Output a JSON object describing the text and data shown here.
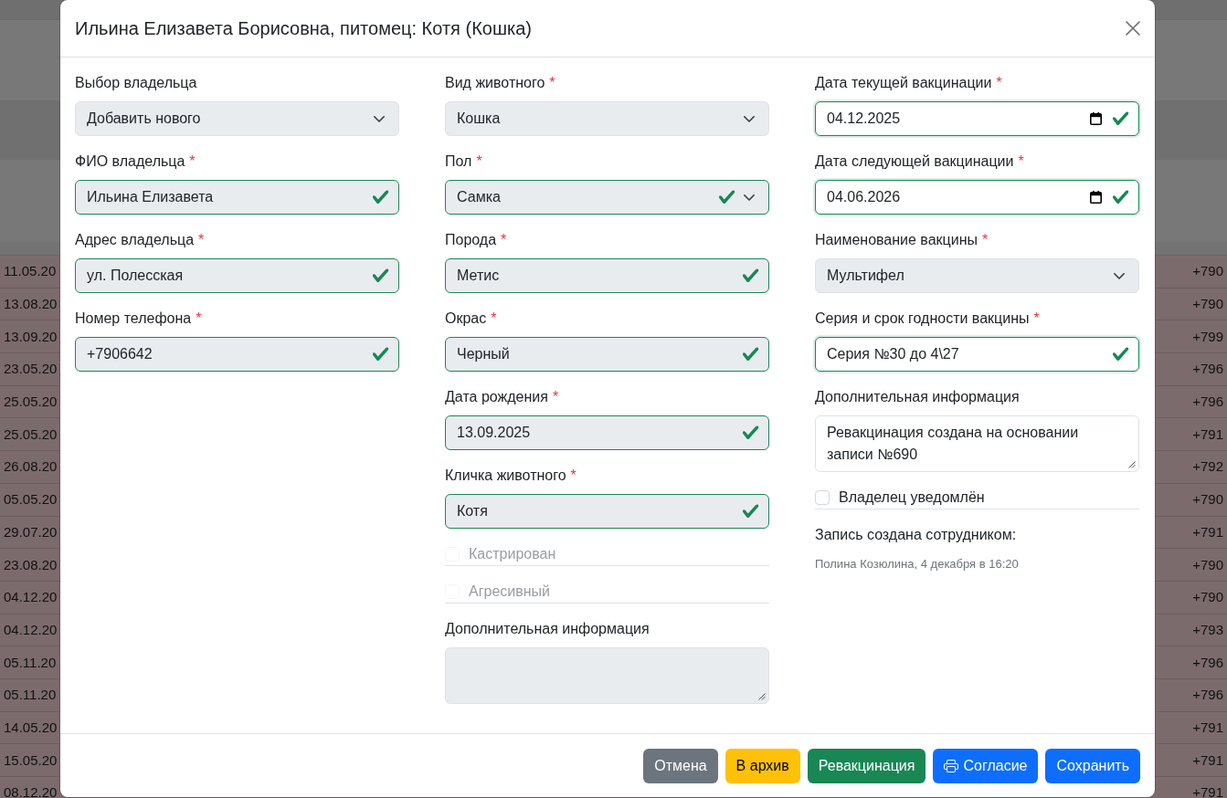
{
  "background_table": {
    "rows": [
      {
        "date": "11.05.20",
        "phone": "+790"
      },
      {
        "date": "13.08.20",
        "phone": "+790"
      },
      {
        "date": "13.09.20",
        "phone": "+799"
      },
      {
        "date": "23.05.20",
        "phone": "+796"
      },
      {
        "date": "25.05.20",
        "phone": "+796"
      },
      {
        "date": "25.05.20",
        "phone": "+791"
      },
      {
        "date": "26.08.20",
        "phone": "+792"
      },
      {
        "date": "05.05.20",
        "phone": "+790"
      },
      {
        "date": "29.07.20",
        "phone": "+791"
      },
      {
        "date": "23.08.20",
        "phone": "+790"
      },
      {
        "date": "04.12.20",
        "phone": "+790"
      },
      {
        "date": "04.12.20",
        "phone": "+793"
      },
      {
        "date": "05.11.20",
        "phone": "+796"
      },
      {
        "date": "05.11.20",
        "phone": "+796"
      },
      {
        "date": "14.05.20",
        "phone": "+791"
      },
      {
        "date": "15.05.20",
        "phone": "+791"
      },
      {
        "date": "08.12.20",
        "phone": "+791"
      }
    ]
  },
  "modal": {
    "title": "Ильина Елизавета Борисовна, питомец: Котя (Кошка)",
    "columns": [
      {
        "items": [
          {
            "kind": "select",
            "label": "Выбор владельца",
            "value": "Добавить нового",
            "disabled": true,
            "valid": false
          },
          {
            "kind": "text",
            "label": "ФИО владельца",
            "required_mark": "*",
            "value": "Ильина Елизавета",
            "disabled": true,
            "valid": true
          },
          {
            "kind": "text",
            "label": "Адрес владельца",
            "required_mark": "*",
            "value": "ул. Полесская",
            "disabled": true,
            "valid": true
          },
          {
            "kind": "text",
            "label": "Номер телефона",
            "required_mark": "*",
            "value": "+7906642",
            "disabled": true,
            "valid": true
          }
        ]
      },
      {
        "items": [
          {
            "kind": "select",
            "label": "Вид животного",
            "required_mark": "*",
            "value": "Кошка",
            "disabled": true,
            "valid": false
          },
          {
            "kind": "select",
            "label": "Пол",
            "required_mark": "*",
            "value": "Самка",
            "disabled": true,
            "valid": true
          },
          {
            "kind": "text",
            "label": "Порода",
            "required_mark": "*",
            "value": "Метис",
            "disabled": true,
            "valid": true
          },
          {
            "kind": "text",
            "label": "Окрас",
            "required_mark": "*",
            "value": "Черный",
            "disabled": true,
            "valid": true
          },
          {
            "kind": "text",
            "label": "Дата рождения",
            "required_mark": "*",
            "value": "13.09.2025",
            "disabled": true,
            "valid": true
          },
          {
            "kind": "text",
            "label": "Кличка животного",
            "required_mark": "*",
            "value": "Котя",
            "disabled": true,
            "valid": true
          },
          {
            "kind": "checkbox",
            "label": "Кастрирован",
            "checked": false,
            "disabled": true
          },
          {
            "kind": "checkbox",
            "label": "Агресивный",
            "checked": false,
            "disabled": true
          },
          {
            "kind": "textarea",
            "label": "Дополнительная информация",
            "disabled": true
          }
        ]
      },
      {
        "items": [
          {
            "kind": "date",
            "label": "Дата текущей вакцинации",
            "required_mark": "*",
            "value": "04.12.2025",
            "disabled": false,
            "valid": true
          },
          {
            "kind": "date",
            "label": "Дата следующей вакцинации",
            "required_mark": "*",
            "value": "04.06.2026",
            "disabled": false,
            "valid": true
          },
          {
            "kind": "select",
            "label": "Наименование вакцины",
            "required_mark": "*",
            "value": "Мультифел",
            "disabled": true,
            "valid": false
          },
          {
            "kind": "text",
            "label": "Серия и срок годности вакцины",
            "required_mark": "*",
            "value": "Серия №30 до 4\\27",
            "disabled": false,
            "valid": true
          },
          {
            "kind": "textarea",
            "label": "Дополнительная информация",
            "value": "Ревакцинация создана на основании записи №690",
            "disabled": false
          },
          {
            "kind": "checkbox",
            "label": "Владелец уведомлён",
            "checked": false,
            "disabled": false
          },
          {
            "kind": "note",
            "label": "Запись создана сотрудником:",
            "detail": "Полина Козюлина, 4 декабря в 16:20"
          }
        ]
      }
    ],
    "buttons": [
      {
        "kind": "cancel",
        "label": "Отмена"
      },
      {
        "kind": "archive",
        "label": "В архив"
      },
      {
        "kind": "revaccinate",
        "label": "Ревакцинация"
      },
      {
        "kind": "print",
        "label": "Согласие"
      },
      {
        "kind": "save",
        "label": "Сохранить"
      }
    ]
  }
}
